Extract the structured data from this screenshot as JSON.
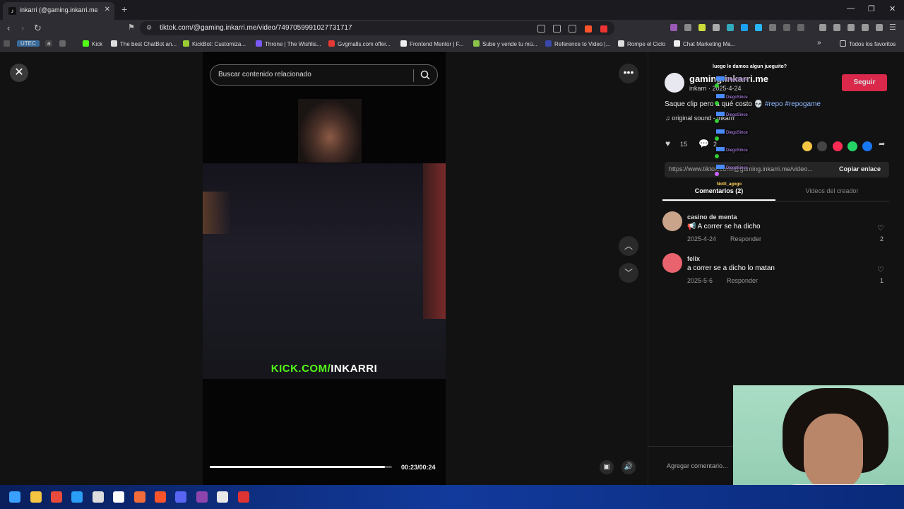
{
  "browser": {
    "tab_title": "inkarri (@gaming.inkarri.me) |",
    "url": "tiktok.com/@gaming.inkarri.me/video/7497059991027731717",
    "bookmarks": [
      "UTEC",
      "a",
      "Kick",
      "The best ChatBot an...",
      "KickBot: Customiza...",
      "Throne | The Wishlis...",
      "Gvgmalls.com offer...",
      "Frontend Mentor | F...",
      "Sube y vende tu mú...",
      "Reference to Video |...",
      "Rompe el Ciclo",
      "Chat Marketing Ma..."
    ],
    "all_bookmarks": "Todos los favoritos"
  },
  "video": {
    "search_placeholder": "Buscar contenido relacionado",
    "overlay_text_green": "KICK.COM/",
    "overlay_text_white": "INKARRI",
    "time": "00:23/00:24",
    "progress": 0.96
  },
  "panel": {
    "username": "gaming.inkarri.me",
    "subname": "inkarri · 2025-4-24",
    "follow_label": "Seguir",
    "caption_text": "Saque clip pero a qué costo 💀",
    "caption_tags": "#repo #repogame",
    "music": "♫ original sound - inkarri",
    "likes": "15",
    "comments_count": "2",
    "link": "https://www.tiktok.com/@gaming.inkarri.me/video...",
    "copy_label": "Copiar enlace",
    "tab_comments": "Comentarios (2)",
    "tab_creator": "Videos del creador",
    "add_comment": "Agregar comentario..."
  },
  "comments": [
    {
      "name": "casino de menta",
      "text": "📢 A correr se ha dicho",
      "date": "2025-4-24",
      "reply": "Responder",
      "likes": "2"
    },
    {
      "name": "felix",
      "text": "a correr se a dicho lo matan",
      "date": "2025-5-6",
      "reply": "Responder",
      "likes": "1"
    }
  ],
  "chat": {
    "header": "luego le damos algun jueguito?",
    "user": "DiegoSince",
    "last": "Nottl_agogo"
  },
  "colors": {
    "accent": "#fe2c55",
    "kick_green": "#53fc18",
    "taskbar": "#123a9c"
  }
}
